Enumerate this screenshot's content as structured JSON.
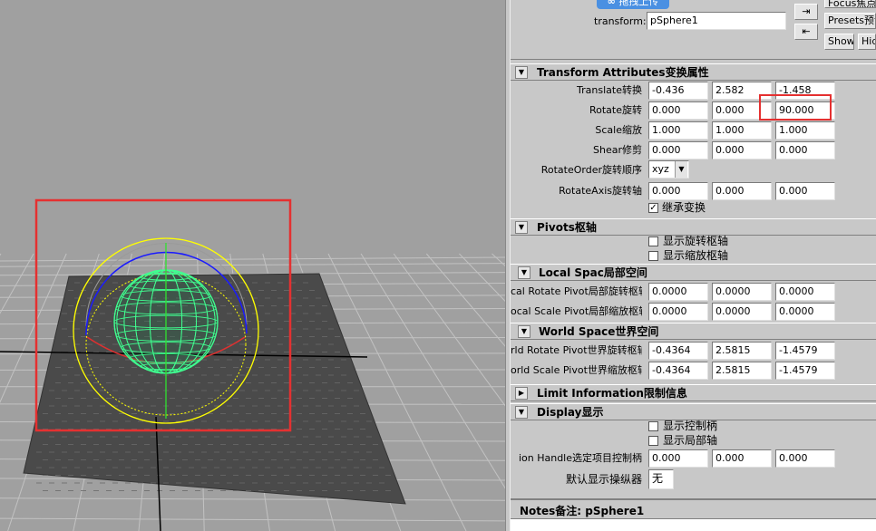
{
  "top": {
    "upload_label": "拖拽上传",
    "transform_label": "transform:",
    "transform_value": "pSphere1",
    "focus_label": "Focus焦点",
    "presets_label": "Presets预设",
    "show_label": "Show",
    "hide_label": "Hid"
  },
  "transform_section": {
    "title": "Transform Attributes变换属性",
    "rows": [
      {
        "label": "Translate转换",
        "values": [
          "-0.436",
          "2.582",
          "-1.458"
        ]
      },
      {
        "label": "Rotate旋转",
        "values": [
          "0.000",
          "0.000",
          "90.000"
        ]
      },
      {
        "label": "Scale缩放",
        "values": [
          "1.000",
          "1.000",
          "1.000"
        ]
      },
      {
        "label": "Shear修剪",
        "values": [
          "0.000",
          "0.000",
          "0.000"
        ]
      }
    ],
    "rotate_order_label": "RotateOrder旋转顺序",
    "rotate_order_value": "xyz",
    "rotate_axis_label": "RotateAxis旋转轴",
    "rotate_axis_values": [
      "0.000",
      "0.000",
      "0.000"
    ],
    "inherit_label": "继承变换"
  },
  "pivots_section": {
    "title": "Pivots枢轴",
    "show_rotate_pivot": "显示旋转枢轴",
    "show_scale_pivot": "显示缩放枢轴"
  },
  "local_space_section": {
    "title": "Local Spac局部空间",
    "rows": [
      {
        "label": "cal Rotate Pivot局部旋转枢轴",
        "values": [
          "0.0000",
          "0.0000",
          "0.0000"
        ]
      },
      {
        "label": "ocal Scale Pivot局部缩放枢轴",
        "values": [
          "0.0000",
          "0.0000",
          "0.0000"
        ]
      }
    ]
  },
  "world_space_section": {
    "title": "World Space世界空间",
    "rows": [
      {
        "label": "rld Rotate Pivot世界旋转枢轴",
        "values": [
          "-0.4364",
          "2.5815",
          "-1.4579"
        ]
      },
      {
        "label": "orld Scale Pivot世界缩放枢轴",
        "values": [
          "-0.4364",
          "2.5815",
          "-1.4579"
        ]
      }
    ]
  },
  "limit_section": {
    "title": "Limit Information限制信息"
  },
  "display_section": {
    "title": "Display显示",
    "show_handle": "显示控制柄",
    "show_local_axis": "显示局部轴",
    "selection_handle_label": "ion Handle选定项目控制柄",
    "selection_handle_values": [
      "0.000",
      "0.000",
      "0.000"
    ],
    "default_manip_label": "默认显示操纵器",
    "default_manip_value": "无"
  },
  "notes": {
    "title": "Notes备注: pSphere1"
  },
  "colors": {
    "viewport_bg": "#a0a0a0",
    "grid": "#c2c2c2",
    "plane": "#4a4a4a",
    "sphere": "#40ff90",
    "manip_yellow": "#ffff00",
    "manip_blue": "#1a1aff",
    "manip_red": "#e03030",
    "highlight_red": "#e53030"
  }
}
